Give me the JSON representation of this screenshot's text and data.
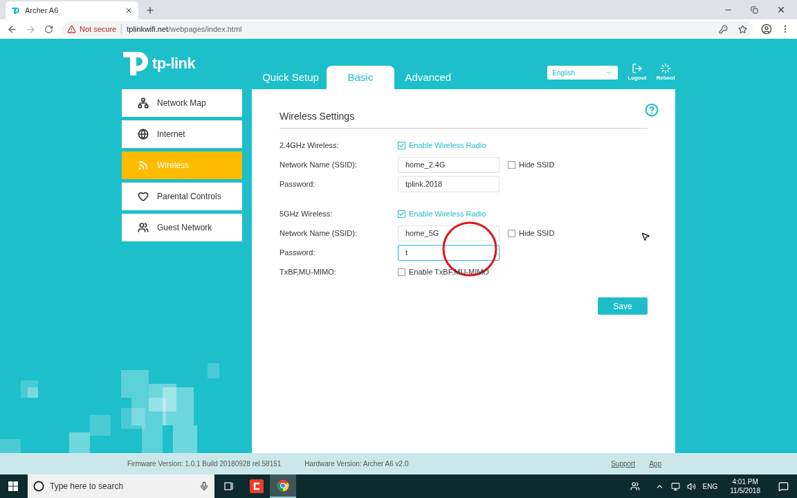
{
  "browser": {
    "tab": {
      "title": "Archer A6"
    },
    "security": "Not secure",
    "url_host": "tplinkwifi.net",
    "url_path": "/webpages/index.html"
  },
  "header": {
    "logo": "tp-link",
    "tabs": [
      {
        "label": "Quick Setup",
        "selected": false
      },
      {
        "label": "Basic",
        "selected": true
      },
      {
        "label": "Advanced",
        "selected": false
      }
    ],
    "language": "English",
    "actions": [
      {
        "kind": "logout",
        "label": "Logout"
      },
      {
        "kind": "reboot",
        "label": "Reboot"
      }
    ]
  },
  "sidebar": {
    "items": [
      {
        "kind": "map",
        "label": "Network Map",
        "selected": false
      },
      {
        "kind": "internet",
        "label": "Internet",
        "selected": false
      },
      {
        "kind": "wireless",
        "label": "Wireless",
        "selected": true
      },
      {
        "kind": "parental",
        "label": "Parental Controls",
        "selected": false
      },
      {
        "kind": "guest",
        "label": "Guest Network",
        "selected": false
      }
    ]
  },
  "panel": {
    "title": "Wireless Settings",
    "sections": [
      {
        "rows": [
          {
            "kind": "checkbox",
            "label": "2.4GHz Wireless:",
            "option": "Enable Wireless Radio",
            "checked": true
          },
          {
            "kind": "text",
            "label": "Network Name (SSID):",
            "value": "home_2.4G",
            "focused": false,
            "extra": {
              "option": "Hide SSID",
              "checked": false
            }
          },
          {
            "kind": "text",
            "label": "Password:",
            "value": "tplink.2018",
            "focused": false
          }
        ]
      },
      {
        "rows": [
          {
            "kind": "checkbox",
            "label": "5GHz Wireless:",
            "option": "Enable Wireless Radio",
            "checked": true
          },
          {
            "kind": "text",
            "label": "Network Name (SSID):",
            "value": "home_5G",
            "focused": false,
            "extra": {
              "option": "Hide SSID",
              "checked": false
            }
          },
          {
            "kind": "text",
            "label": "Password:",
            "value": "t",
            "focused": true
          },
          {
            "kind": "checkbox",
            "label": "TxBF,MU-MIMO:",
            "option": "Enable TxBF,MU-MIMO",
            "checked": false
          }
        ]
      }
    ],
    "save": "Save"
  },
  "footer": {
    "firmware": "Firmware Version: 1.0.1 Build 20180928 rel.58151",
    "hardware": "Hardware Version: Archer A6 v2.0",
    "links": [
      "Support",
      "App"
    ]
  },
  "taskbar": {
    "search_placeholder": "Type here to search",
    "apps": [
      {
        "kind": "app",
        "selected": false
      },
      {
        "kind": "chrome",
        "selected": true
      }
    ],
    "language": "ENG",
    "time": "4:01 PM",
    "date": "11/5/2018"
  }
}
